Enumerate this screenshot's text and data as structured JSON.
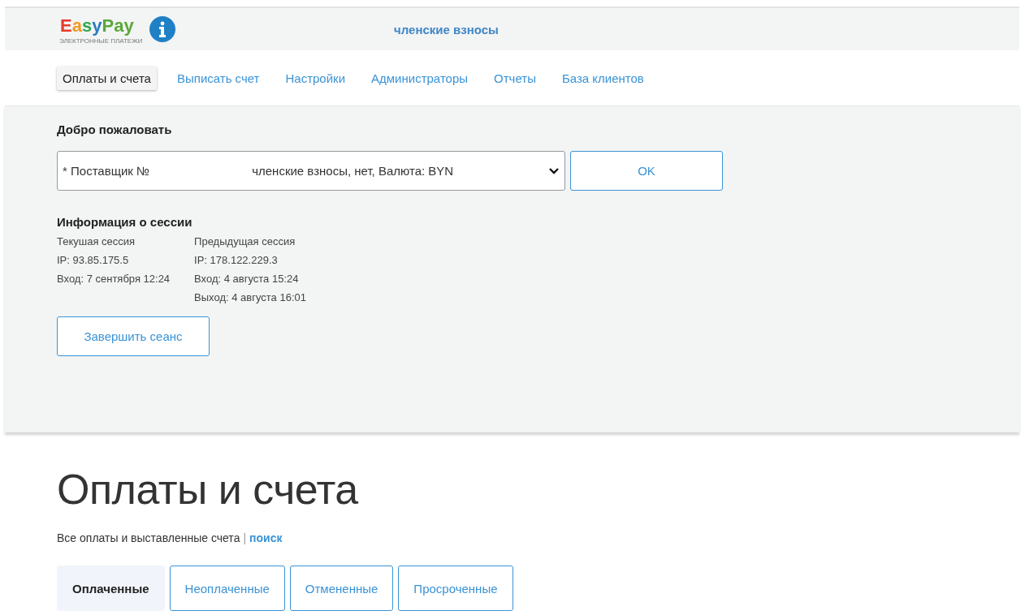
{
  "header": {
    "logo": "EasyPay",
    "logo_tagline": "ЭЛЕКТРОННЫЕ ПЛАТЕЖИ",
    "title": "членские взносы"
  },
  "nav": [
    {
      "label": "Оплаты и счета",
      "selected": true
    },
    {
      "label": "Выписать счет",
      "selected": false
    },
    {
      "label": "Настройки",
      "selected": false
    },
    {
      "label": "Администраторы",
      "selected": false
    },
    {
      "label": "Отчеты",
      "selected": false
    },
    {
      "label": "База клиентов",
      "selected": false
    }
  ],
  "welcome": {
    "title": "Добро пожаловать",
    "provider_select": {
      "value_start": "* Поставщик №",
      "value_end": "членские взносы, нет, Валюта: BYN"
    },
    "ok_button": "OK"
  },
  "session": {
    "title": "Информация о сессии",
    "columns": [
      {
        "lines": [
          "Текушая сессия",
          "IP: 93.85.175.5",
          "Вход: 7 сентября 12:24"
        ]
      },
      {
        "lines": [
          "Предыдущая сессия",
          "IP: 178.122.229.3",
          "Вход: 4 августа 15:24",
          "Выход: 4 августа 16:01"
        ]
      }
    ],
    "logout_button": "Завершить сеанс"
  },
  "page": {
    "title": "Оплаты и счета",
    "subtitle": "Все оплаты и выставленные счета",
    "separator": "|",
    "search_link": "поиск"
  },
  "tabs": [
    {
      "label": "Оплаченные",
      "selected": true
    },
    {
      "label": "Неоплаченные",
      "selected": false
    },
    {
      "label": "Отмененные",
      "selected": false
    },
    {
      "label": "Просроченные",
      "selected": false
    }
  ]
}
